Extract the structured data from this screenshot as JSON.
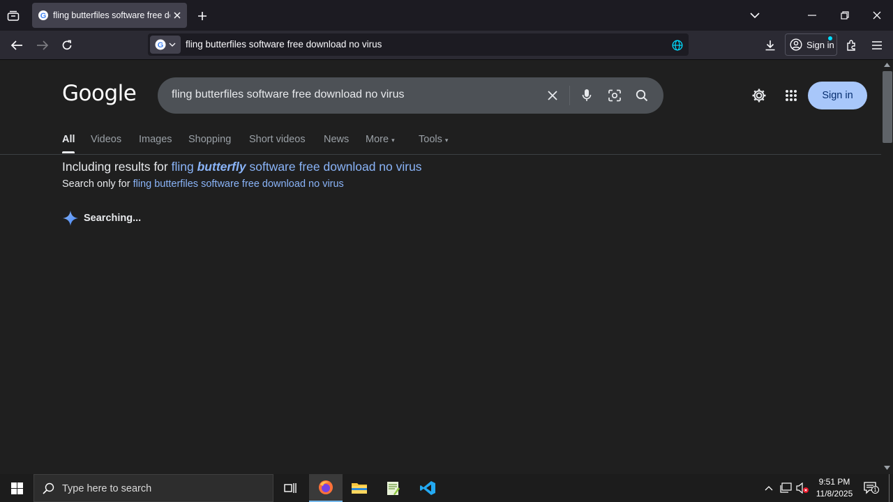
{
  "browser": {
    "tab_title": "fling butterfiles software free do",
    "url_text": "fling butterfiles software free download no virus",
    "signin_label": "Sign in"
  },
  "google": {
    "logo": "Google",
    "query": "fling butterfiles software free download no virus",
    "signin_label": "Sign in",
    "tabs": [
      "All",
      "Videos",
      "Images",
      "Shopping",
      "Short videos",
      "News",
      "More",
      "Tools"
    ],
    "including_prefix": "Including results for",
    "corrected_pre": "fling",
    "corrected_bold": "butterfly",
    "corrected_post": "software free download no virus",
    "only_prefix": "Search only for",
    "only_link": "fling butterfiles software free download no virus",
    "status": "Searching..."
  },
  "taskbar": {
    "search_placeholder": "Type here to search",
    "time": "9:51 PM",
    "date": "11/8/2025",
    "notification_count": "1"
  },
  "colors": {
    "link": "#8ab4f8",
    "signin_bg": "#a8c7fa",
    "page_bg": "#1f1f1f"
  }
}
